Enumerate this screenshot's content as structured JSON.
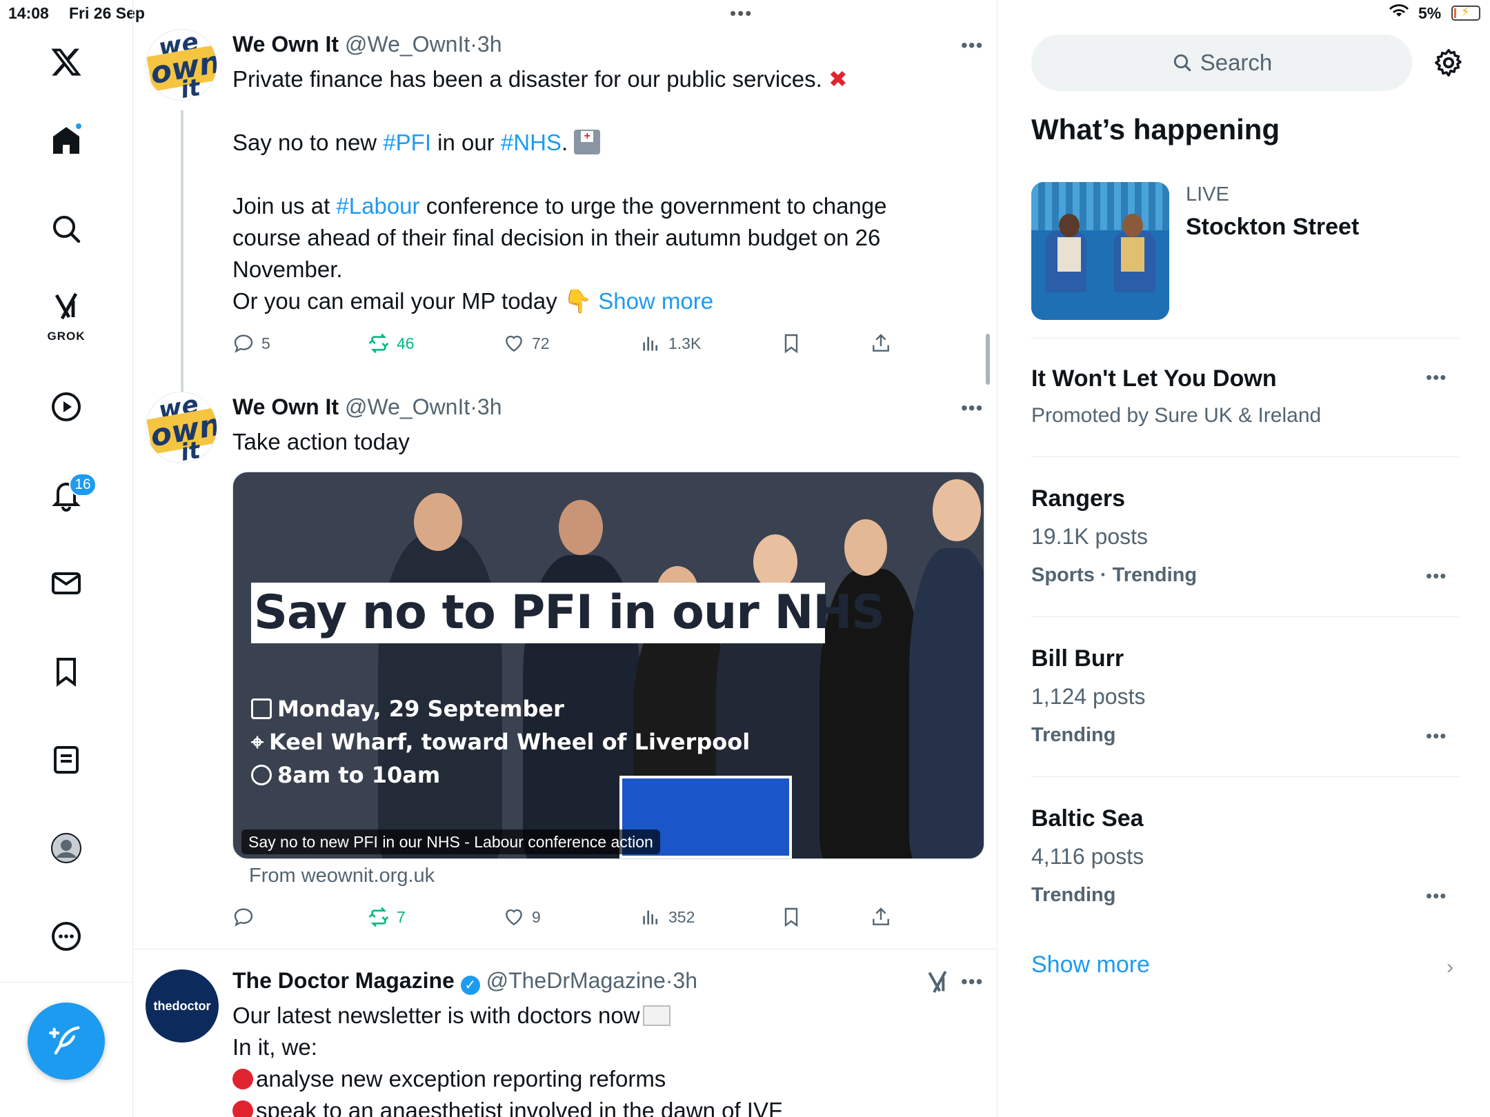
{
  "status_bar": {
    "time": "14:08",
    "date": "Fri 26 Sep",
    "battery": "5%"
  },
  "nav": {
    "grok_label": "GROK",
    "notification_count": "16"
  },
  "tweets": [
    {
      "name": "We Own It",
      "handle": "@We_OwnIt",
      "time": "3h",
      "lines": {
        "l1": "Private finance has been a disaster for our public services.",
        "l2a": "Say no to new ",
        "l2tag1": "#PFI",
        "l2b": " in our ",
        "l2tag2": "#NHS",
        "l2c": ".",
        "l3a": "Join us at ",
        "l3tag": "#Labour",
        "l3b": " conference to urge the government to change",
        "l4": "course ahead of their final decision in their autumn budget on 26",
        "l5": "November.",
        "l6": "Or you can email your MP today",
        "show_more": "Show more"
      },
      "stats": {
        "replies": "5",
        "reposts": "46",
        "likes": "72",
        "views": "1.3K"
      }
    },
    {
      "name": "We Own It",
      "handle": "@We_OwnIt",
      "time": "3h",
      "text": "Take action today",
      "media": {
        "banner": "Say no to PFI in our NHS",
        "date": "Monday, 29 September",
        "location": "Keel Wharf, toward Wheel of Liverpool",
        "hours": "8am to 10am",
        "caption": "Say no to new PFI in our NHS - Labour conference action",
        "source": "From weownit.org.uk"
      },
      "stats": {
        "replies": "",
        "reposts": "7",
        "likes": "9",
        "views": "352"
      }
    },
    {
      "name": "The Doctor Magazine",
      "handle": "@TheDrMagazine",
      "time": "3h",
      "avatar_text": "thedoctor",
      "lines": {
        "l1": "Our latest newsletter is with doctors now",
        "l2": "In it, we:",
        "l3": "analyse new exception reporting reforms",
        "l4": "speak to an anaesthetist involved in the dawn of IVF"
      }
    }
  ],
  "sidebar": {
    "search_placeholder": "Search",
    "whats_happening": "What’s happening",
    "live": {
      "label": "LIVE",
      "title": "Stockton Street"
    },
    "trends": [
      {
        "title": "It Won't Let You Down",
        "sub": "Promoted by Sure UK & Ireland",
        "meta": ""
      },
      {
        "title": "Rangers",
        "sub": "19.1K posts",
        "meta": "Sports · Trending"
      },
      {
        "title": "Bill Burr",
        "sub": "1,124 posts",
        "meta": "Trending"
      },
      {
        "title": "Baltic Sea",
        "sub": "4,116 posts",
        "meta": "Trending"
      }
    ],
    "show_more": "Show more"
  },
  "colors": {
    "accent": "#1d9bf0",
    "repost": "#00ba7c",
    "text": "#0f1419",
    "muted": "#536471"
  }
}
